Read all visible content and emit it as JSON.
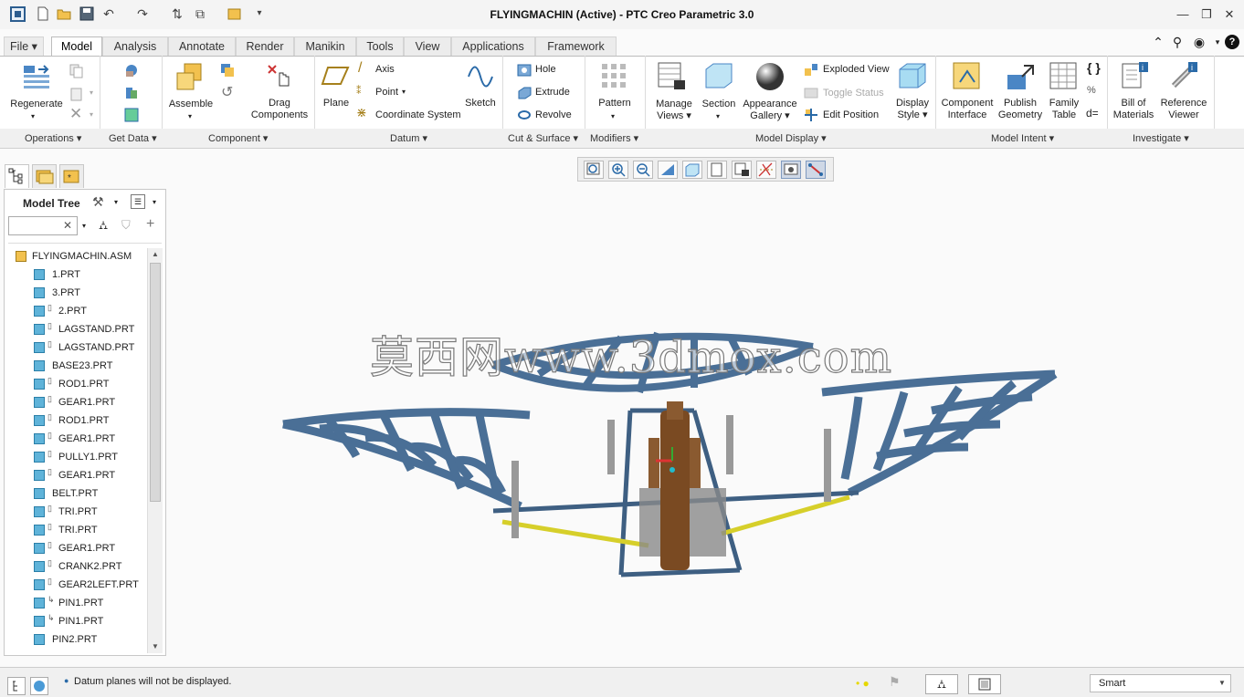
{
  "window": {
    "title": "FLYINGMACHIN (Active) - PTC Creo Parametric 3.0"
  },
  "tabs": [
    {
      "label": "File"
    },
    {
      "label": "Model"
    },
    {
      "label": "Analysis"
    },
    {
      "label": "Annotate"
    },
    {
      "label": "Render"
    },
    {
      "label": "Manikin"
    },
    {
      "label": "Tools"
    },
    {
      "label": "View"
    },
    {
      "label": "Applications"
    },
    {
      "label": "Framework"
    }
  ],
  "ribbon": {
    "regenerate": "Regenerate",
    "assemble": "Assemble",
    "drag_components": "Drag\nComponents",
    "plane": "Plane",
    "axis": "Axis",
    "point": "Point",
    "coordinate_system": "Coordinate System",
    "sketch": "Sketch",
    "hole": "Hole",
    "extrude": "Extrude",
    "revolve": "Revolve",
    "pattern": "Pattern",
    "manage_views": "Manage\nViews",
    "section": "Section",
    "appearance_gallery": "Appearance\nGallery",
    "exploded_view": "Exploded View",
    "toggle_status": "Toggle Status",
    "edit_position": "Edit Position",
    "display_style": "Display\nStyle",
    "component_interface": "Component\nInterface",
    "publish_geometry": "Publish\nGeometry",
    "family_table": "Family\nTable",
    "bill_of_materials": "Bill of\nMaterials",
    "reference_viewer": "Reference\nViewer"
  },
  "groups": {
    "operations": "Operations",
    "get_data": "Get Data",
    "component": "Component",
    "datum": "Datum",
    "cut_surface": "Cut & Surface",
    "modifiers": "Modifiers",
    "model_display": "Model Display",
    "model_intent": "Model Intent",
    "investigate": "Investigate"
  },
  "model_tree": {
    "title": "Model Tree",
    "root": "FLYINGMACHIN.ASM",
    "items": [
      {
        "name": "1.PRT",
        "sym": ""
      },
      {
        "name": "3.PRT",
        "sym": ""
      },
      {
        "name": "2.PRT",
        "sym": "▯"
      },
      {
        "name": "LAGSTAND.PRT",
        "sym": "▯"
      },
      {
        "name": "LAGSTAND.PRT",
        "sym": "▯"
      },
      {
        "name": "BASE23.PRT",
        "sym": ""
      },
      {
        "name": "ROD1.PRT",
        "sym": "▯"
      },
      {
        "name": "GEAR1.PRT",
        "sym": "▯"
      },
      {
        "name": "ROD1.PRT",
        "sym": "▯"
      },
      {
        "name": "GEAR1.PRT",
        "sym": "▯"
      },
      {
        "name": "PULLY1.PRT",
        "sym": "▯"
      },
      {
        "name": "GEAR1.PRT",
        "sym": "▯"
      },
      {
        "name": "BELT.PRT",
        "sym": ""
      },
      {
        "name": "TRI.PRT",
        "sym": "▯"
      },
      {
        "name": "TRI.PRT",
        "sym": "▯"
      },
      {
        "name": "GEAR1.PRT",
        "sym": "▯"
      },
      {
        "name": "CRANK2.PRT",
        "sym": "▯"
      },
      {
        "name": "GEAR2LEFT.PRT",
        "sym": "▯"
      },
      {
        "name": "PIN1.PRT",
        "sym": "↳"
      },
      {
        "name": "PIN1.PRT",
        "sym": "↳"
      },
      {
        "name": "PIN2.PRT",
        "sym": ""
      }
    ]
  },
  "status": {
    "message": "Datum planes will not be displayed.",
    "filter": "Smart"
  },
  "watermark": "莫西网www.3dmox.com"
}
